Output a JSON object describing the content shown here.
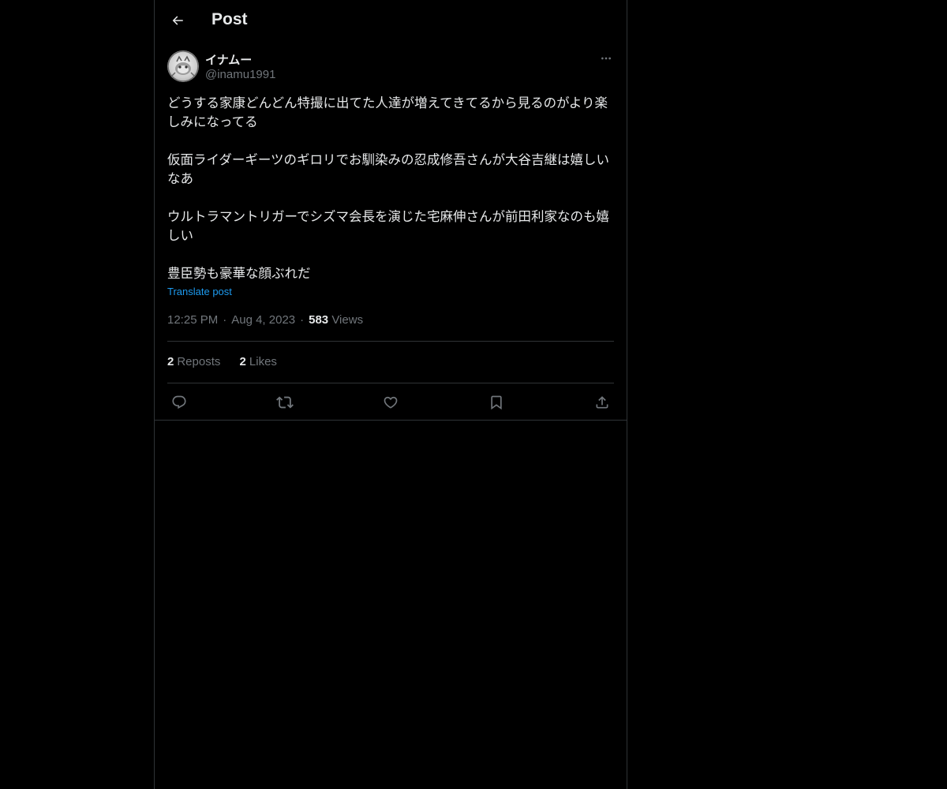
{
  "header": {
    "back_icon": "arrow-left-icon",
    "title": "Post"
  },
  "post": {
    "author": {
      "display_name": "イナムー",
      "handle": "@inamu1991"
    },
    "more_icon": "more-horizontal-icon",
    "paragraphs": [
      "どうする家康どんどん特撮に出てた人達が増えてきてるから見るのがより楽しみになってる",
      "仮面ライダーギーツのギロリでお馴染みの忍成修吾さんが大谷吉継は嬉しいなあ",
      "ウルトラマントリガーでシズマ会長を演じた宅麻伸さんが前田利家なのも嬉しい",
      "豊臣勢も豪華な顔ぶれだ"
    ],
    "translate_label": "Translate post",
    "time": "12:25 PM",
    "date": "Aug 4, 2023",
    "separator": "·",
    "views_count": "583",
    "views_label": "Views",
    "reposts_count": "2",
    "reposts_label": "Reposts",
    "likes_count": "2",
    "likes_label": "Likes"
  },
  "actions": [
    {
      "name": "reply",
      "icon": "reply-icon"
    },
    {
      "name": "repost",
      "icon": "repost-icon"
    },
    {
      "name": "like",
      "icon": "heart-icon"
    },
    {
      "name": "bookmark",
      "icon": "bookmark-icon"
    },
    {
      "name": "share",
      "icon": "share-icon"
    }
  ],
  "colors": {
    "background": "#000000",
    "text_primary": "#e7e9ea",
    "text_secondary": "#71767b",
    "link": "#1d9bf0",
    "border": "#2f3336"
  }
}
